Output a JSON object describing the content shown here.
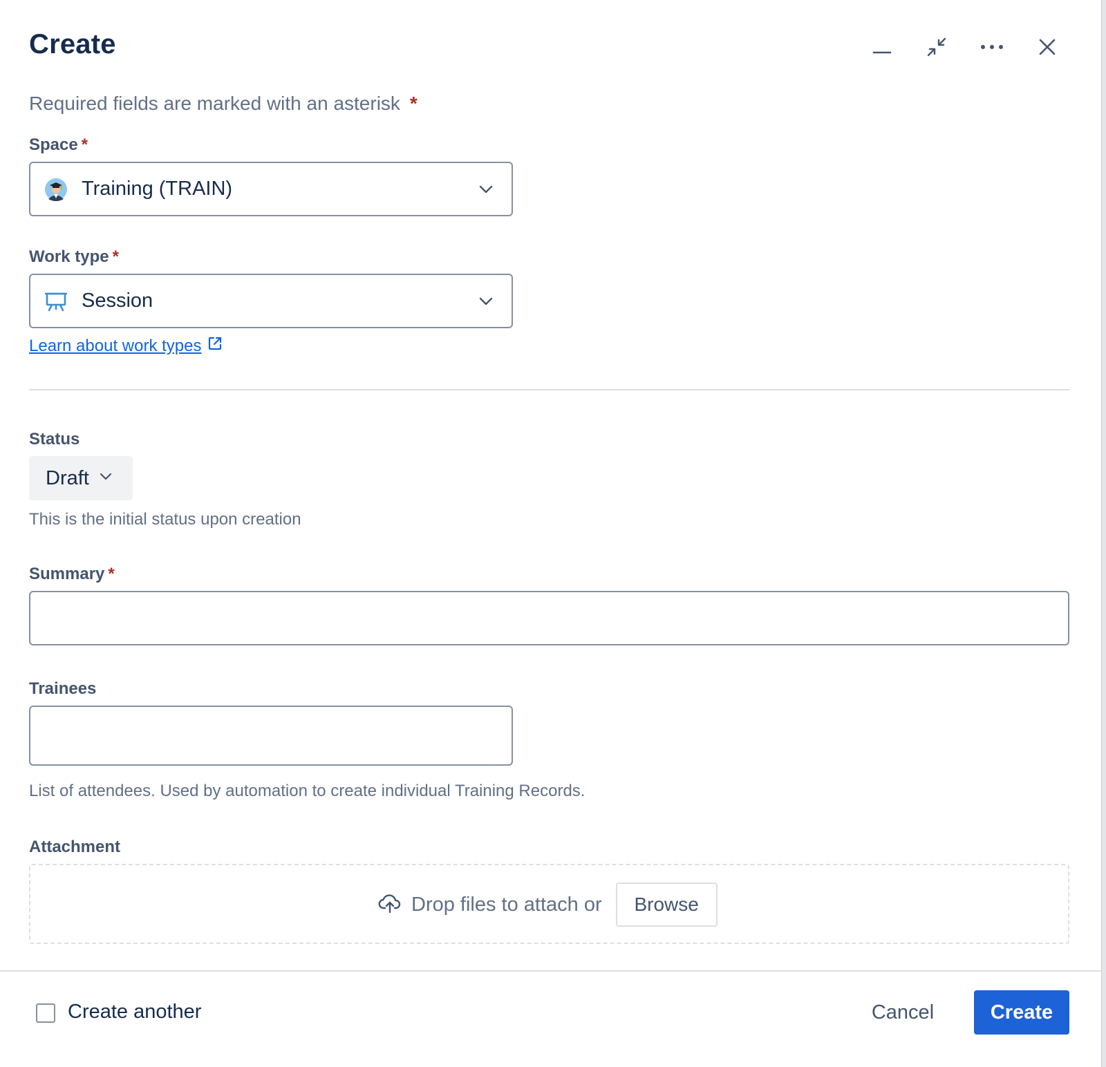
{
  "dialog": {
    "title": "Create",
    "header_icons": [
      "minimize-icon",
      "collapse-icon",
      "more-icon",
      "close-icon"
    ]
  },
  "form": {
    "required_note": "Required fields are marked with an asterisk",
    "asterisk": "*",
    "space": {
      "label": "Space",
      "value": "Training (TRAIN)",
      "icon": "avatar-icon"
    },
    "work_type": {
      "label": "Work type",
      "value": "Session",
      "icon": "presentation-icon",
      "link_text": "Learn about work types"
    },
    "status": {
      "label": "Status",
      "value": "Draft",
      "helper": "This is the initial status upon creation"
    },
    "summary": {
      "label": "Summary",
      "value": ""
    },
    "trainees": {
      "label": "Trainees",
      "value": "",
      "helper": "List of attendees. Used by automation to create individual Training Records."
    },
    "attachment": {
      "label": "Attachment",
      "drop_text": "Drop files to attach or",
      "browse_label": "Browse"
    }
  },
  "footer": {
    "create_another_label": "Create another",
    "create_another_checked": false,
    "cancel_label": "Cancel",
    "create_label": "Create"
  },
  "colors": {
    "primary": "#1d62d6",
    "link": "#0c66e4",
    "asterisk": "#ae2e24",
    "border": "#8590a2"
  }
}
